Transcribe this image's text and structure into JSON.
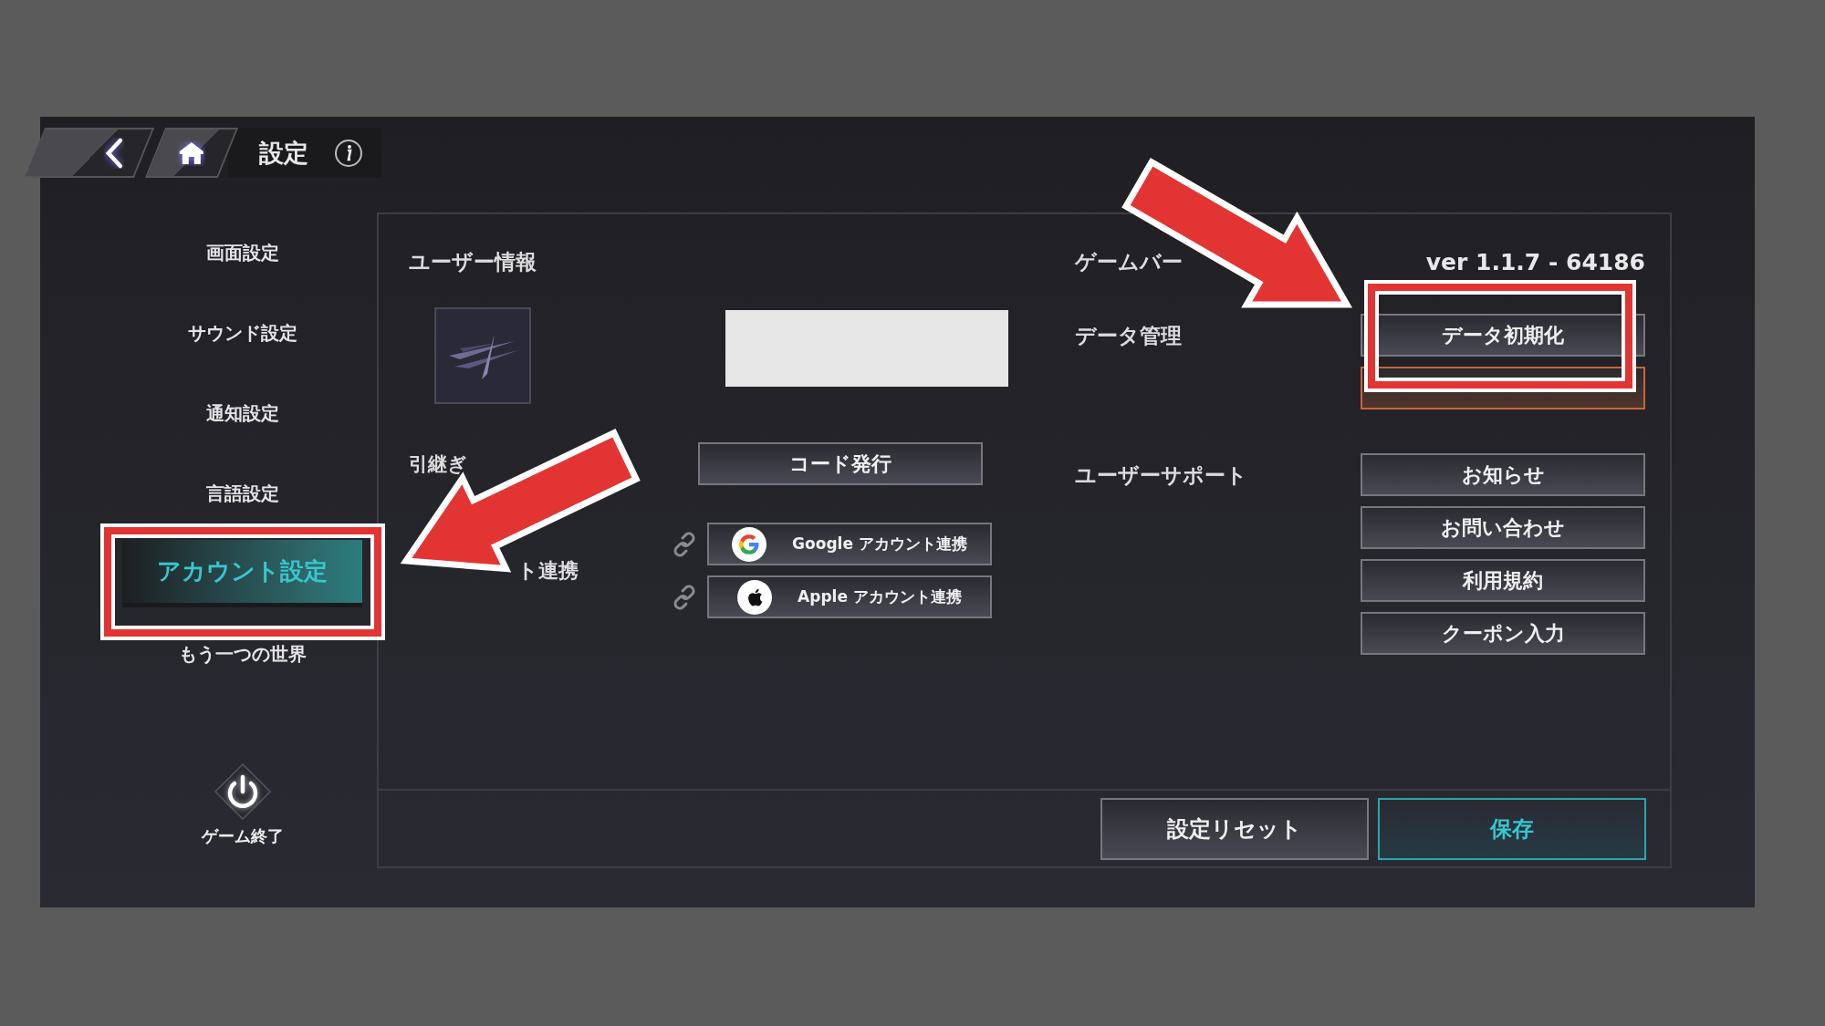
{
  "header": {
    "title": "設定"
  },
  "sidebar": {
    "items": [
      {
        "label": "画面設定",
        "selected": false
      },
      {
        "label": "サウンド設定",
        "selected": false
      },
      {
        "label": "通知設定",
        "selected": false
      },
      {
        "label": "言語設定",
        "selected": false
      },
      {
        "label": "アカウント設定",
        "selected": true
      },
      {
        "label": "もう一つの世界",
        "selected": false
      }
    ],
    "exit_label": "ゲーム終了"
  },
  "user_info": {
    "title": "ユーザー情報",
    "transfer_label": "引継ぎ",
    "code_button": "コード発行",
    "link_label": "ト連携",
    "link_buttons": [
      {
        "kind": "google",
        "label": "Google アカウント連携"
      },
      {
        "kind": "apple",
        "label": "Apple アカウント連携"
      }
    ]
  },
  "settings": {
    "version_label": "ゲームバー",
    "version": "ver 1.1.7 - 64186",
    "data_label": "データ管理",
    "data_buttons": [
      {
        "kind": "normal",
        "label": "データ初期化"
      },
      {
        "kind": "danger"
      }
    ],
    "support_label": "ユーザーサポート",
    "support_buttons": [
      "お知らせ",
      "お問い合わせ",
      "利用規約",
      "クーポン入力"
    ]
  },
  "footer": {
    "buttons": [
      {
        "kind": "normal",
        "label": "設定リセット"
      },
      {
        "kind": "primary",
        "label": "保存"
      }
    ]
  }
}
